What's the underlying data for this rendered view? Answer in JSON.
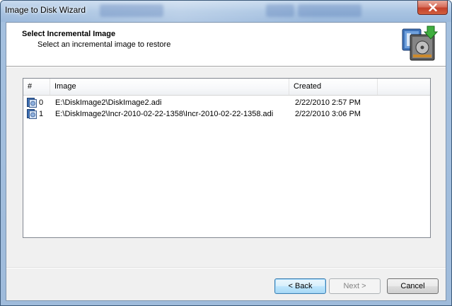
{
  "window": {
    "title": "Image to Disk Wizard"
  },
  "header": {
    "title": "Select Incremental Image",
    "subtitle": "Select an incremental image to restore",
    "icon": "disk-restore-icon"
  },
  "list": {
    "columns": [
      "#",
      "Image",
      "Created"
    ],
    "rows": [
      {
        "index": "0",
        "image": "E:\\DiskImage2\\DiskImage2.adi",
        "created": "2/22/2010 2:57 PM",
        "icon": "disk-image-icon"
      },
      {
        "index": "1",
        "image": "E:\\DiskImage2\\Incr-2010-02-22-1358\\Incr-2010-02-22-1358.adi",
        "created": "2/22/2010 3:06 PM",
        "icon": "disk-image-icon"
      }
    ]
  },
  "buttons": {
    "back": "< Back",
    "next": "Next >",
    "cancel": "Cancel"
  },
  "colors": {
    "client_bg": "#f0f0f0",
    "default_button_border": "#3c7fb1",
    "close_button": "#c3412b"
  }
}
